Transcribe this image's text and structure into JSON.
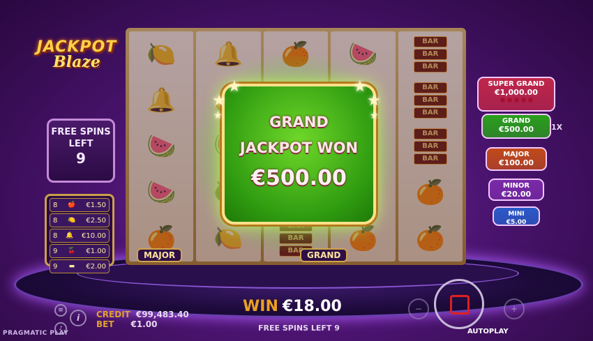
{
  "logo": {
    "line1": "JACKPOT",
    "line2": "Blaze"
  },
  "free_spins_box": {
    "line1": "FREE SPINS",
    "line2": "LEFT",
    "count": "9"
  },
  "paytable": [
    {
      "count": "8",
      "icon": "apple-icon",
      "value": "€1.50"
    },
    {
      "count": "8",
      "icon": "lemon-icon",
      "value": "€2.50"
    },
    {
      "count": "8",
      "icon": "bell-icon",
      "value": "€10.00"
    },
    {
      "count": "9",
      "icon": "cherry-icon",
      "value": "€1.00"
    },
    {
      "count": "9",
      "icon": "bar-icon",
      "value": "€2.00"
    }
  ],
  "reels": [
    [
      "🍋",
      "🔔",
      "🍉",
      "🍉",
      "🍊"
    ],
    [
      "🔔",
      "🍊",
      "🍉",
      "🍋",
      "🍋"
    ],
    [
      "🍊",
      "",
      "",
      "",
      "BAR"
    ],
    [
      "🍉",
      "",
      "",
      "",
      "🍊"
    ],
    [
      "BAR",
      "BAR",
      "BAR",
      "🍊",
      "🍊"
    ]
  ],
  "reel_tags": {
    "major": "MAJOR",
    "grand": "GRAND"
  },
  "win_panel": {
    "line1": "GRAND",
    "line2": "JACKPOT WON",
    "amount": "€500.00"
  },
  "jackpots": [
    {
      "name": "SUPER GRAND",
      "value": "€1,000.00",
      "color": "#c0264a"
    },
    {
      "name": "GRAND",
      "value": "€500.00",
      "color": "#2aa01c"
    },
    {
      "name": "MAJOR",
      "value": "€100.00",
      "color": "#c24a1a"
    },
    {
      "name": "MINOR",
      "value": "€20.00",
      "color": "#7a2aa8"
    },
    {
      "name": "MINI",
      "value": "€5.00",
      "color": "#2a5ac8"
    }
  ],
  "multiplier": "1X",
  "bottom": {
    "credit_label": "CREDIT",
    "credit_value": "€99,483.40",
    "bet_label": "BET",
    "bet_value": "€1.00",
    "win_label": "WIN",
    "win_value": "€18.00",
    "free_spins_left": "FREE SPINS LEFT 9",
    "autoplay": "AUTOPLAY",
    "brand": "PRAGMATIC PLAY"
  }
}
